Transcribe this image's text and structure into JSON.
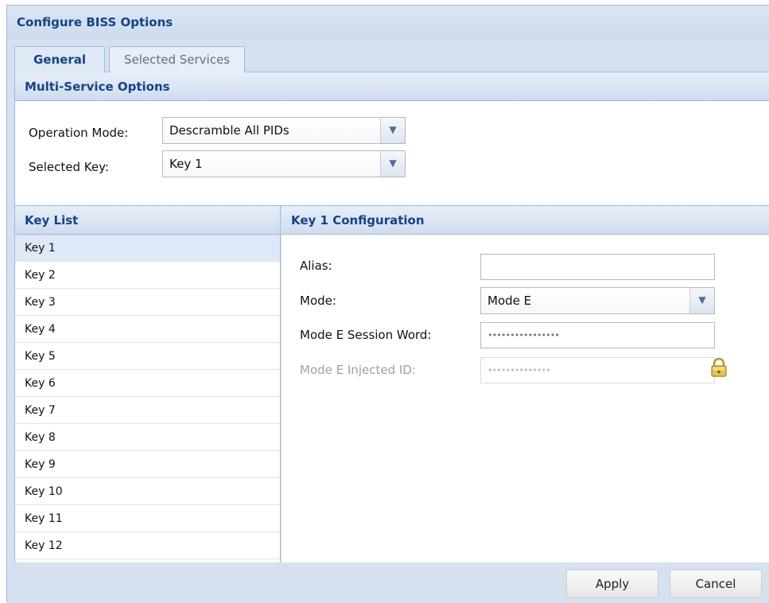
{
  "window": {
    "title": "Configure BISS Options"
  },
  "tabs": [
    {
      "label": "General",
      "active": true
    },
    {
      "label": "Selected Services",
      "active": false
    }
  ],
  "multi_service": {
    "title": "Multi-Service Options",
    "operation_mode": {
      "label": "Operation Mode:",
      "value": "Descramble All PIDs"
    },
    "selected_key": {
      "label": "Selected Key:",
      "value": "Key 1"
    }
  },
  "key_list": {
    "title": "Key List",
    "items": [
      "Key 1",
      "Key 2",
      "Key 3",
      "Key 4",
      "Key 5",
      "Key 6",
      "Key 7",
      "Key 8",
      "Key 9",
      "Key 10",
      "Key 11",
      "Key 12"
    ],
    "selected": "Key 1"
  },
  "key_config": {
    "title": "Key 1 Configuration",
    "alias": {
      "label": "Alias:",
      "value": ""
    },
    "mode": {
      "label": "Mode:",
      "value": "Mode E"
    },
    "session_word": {
      "label": "Mode E Session Word:",
      "value": "••••••••••••••••"
    },
    "injected_id": {
      "label": "Mode E Injected ID:",
      "value": "••••••••••••••",
      "disabled": true,
      "icon": "lock-icon"
    }
  },
  "buttons": {
    "apply": "Apply",
    "cancel": "Cancel"
  },
  "colors": {
    "header_text": "#15428b",
    "panel_bg": "#d5e1ef",
    "border": "#99bbe8",
    "selected_row": "#dfe8f6"
  }
}
